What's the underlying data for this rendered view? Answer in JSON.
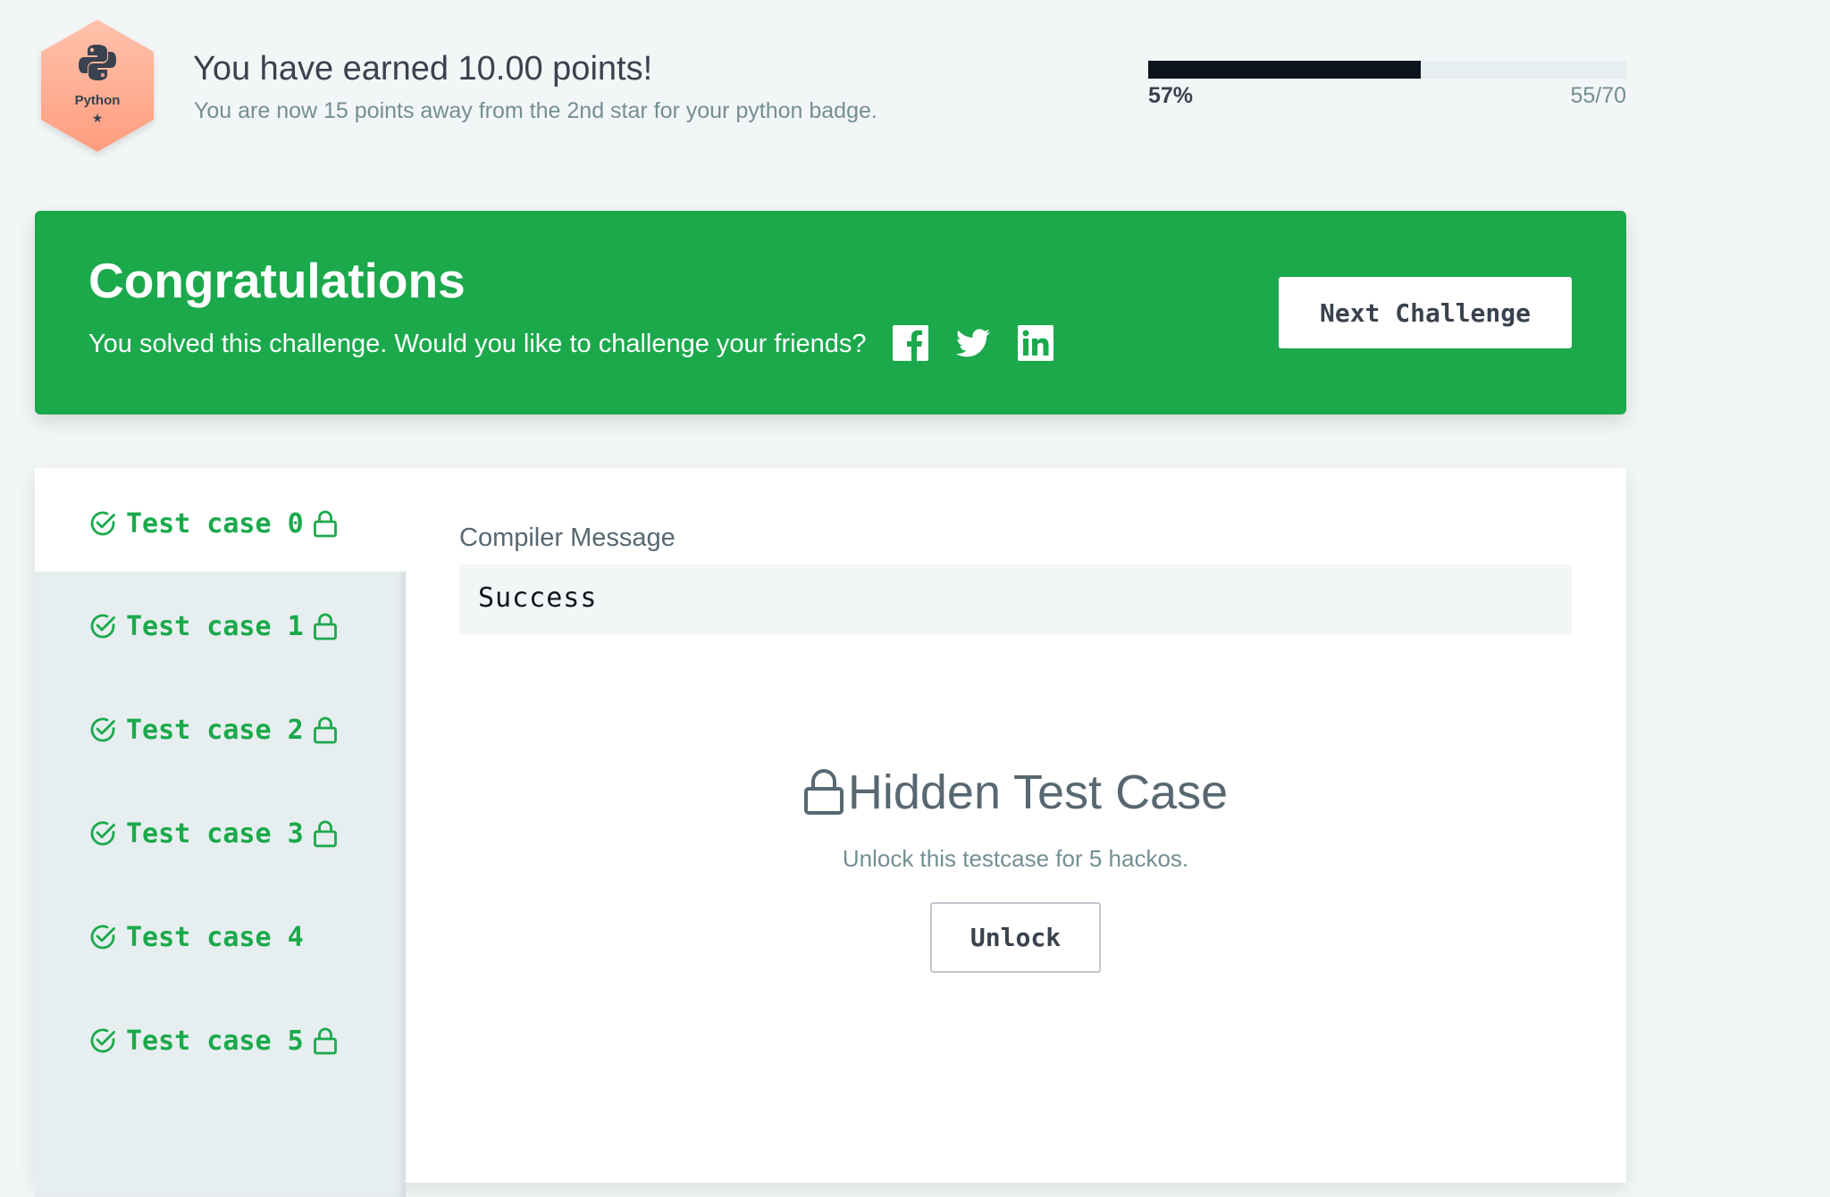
{
  "badge": {
    "name": "Python",
    "stars": "★",
    "icon": "python-logo-icon",
    "colors": {
      "top": "#ffb8a0",
      "bottom": "#ff9f80"
    }
  },
  "points": {
    "title": "You have earned 10.00 points!",
    "subtitle": "You are now 15 points away from the 2nd star for your python badge."
  },
  "progress": {
    "fraction": 0.57,
    "percent_label": "57%",
    "count_label": "55/70"
  },
  "banner": {
    "title": "Congratulations",
    "subtitle": "You solved this challenge. Would you like to challenge your friends?",
    "social_icons": [
      "facebook-icon",
      "twitter-icon",
      "linkedin-icon"
    ],
    "next_button": "Next Challenge",
    "color": "#1ba94c"
  },
  "test_cases": [
    {
      "label": "Test case 0",
      "passed": true,
      "locked": true,
      "selected": true
    },
    {
      "label": "Test case 1",
      "passed": true,
      "locked": true,
      "selected": false
    },
    {
      "label": "Test case 2",
      "passed": true,
      "locked": true,
      "selected": false
    },
    {
      "label": "Test case 3",
      "passed": true,
      "locked": true,
      "selected": false
    },
    {
      "label": "Test case 4",
      "passed": true,
      "locked": false,
      "selected": false
    },
    {
      "label": "Test case 5",
      "passed": true,
      "locked": true,
      "selected": false
    }
  ],
  "compiler": {
    "label": "Compiler Message",
    "message": "Success"
  },
  "hidden": {
    "title": "Hidden Test Case",
    "subtitle": "Unlock this testcase for 5 hackos.",
    "unlock_button": "Unlock"
  }
}
